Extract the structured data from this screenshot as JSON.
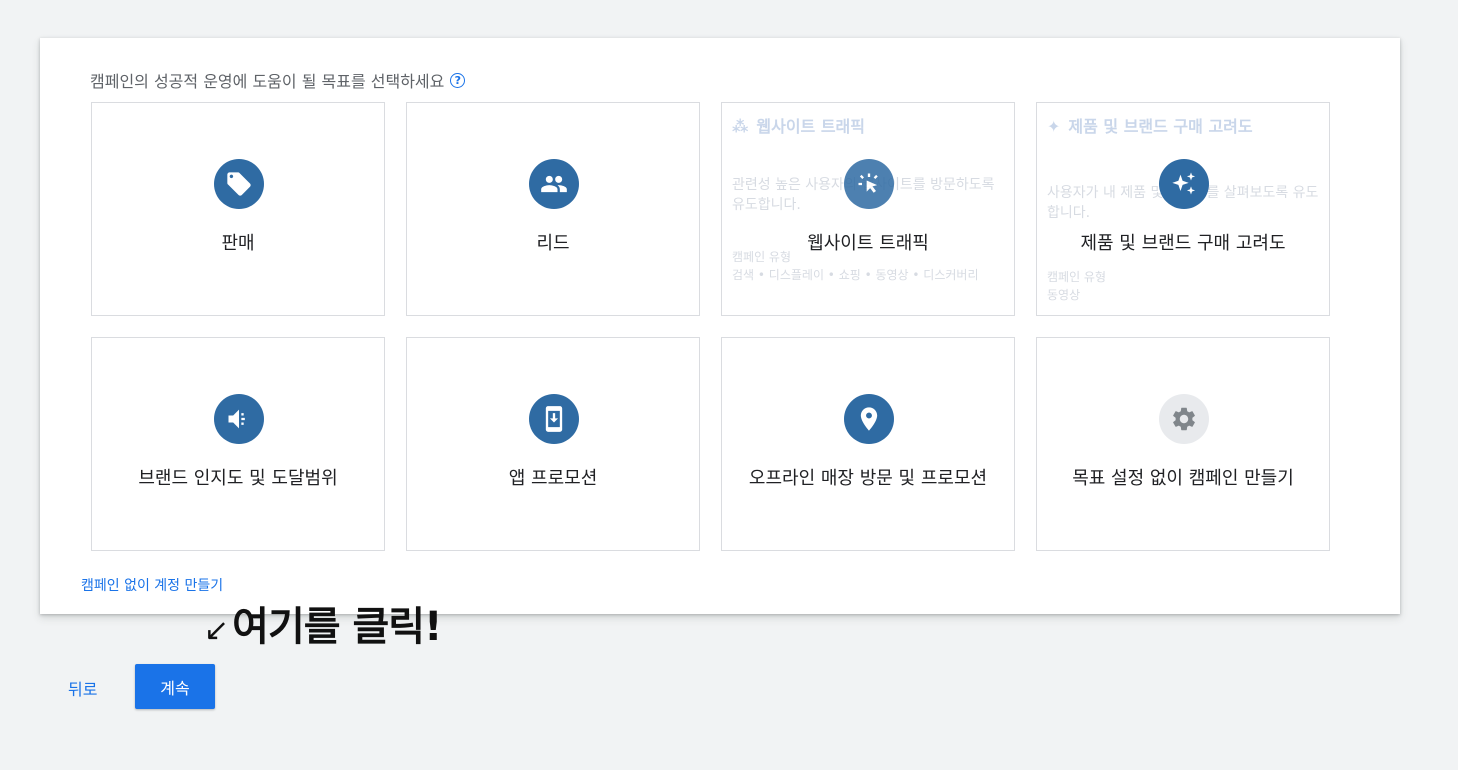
{
  "heading": {
    "text": "캠페인의 성공적 운영에 도움이 될 목표를 선택하세요",
    "help_glyph": "?"
  },
  "goals": [
    {
      "label": "판매",
      "icon": "tag-icon"
    },
    {
      "label": "리드",
      "icon": "people-icon"
    },
    {
      "label": "웹사이트 트래픽",
      "icon": "cursor-click-icon",
      "detail": {
        "title": "웹사이트 트래픽",
        "description": "관련성 높은 사용자의 웹사이트를 방문하도록 유도합니다.",
        "type_label": "캠페인 유형",
        "types": "검색 • 디스플레이 • 쇼핑 • 동영상 • 디스커버리"
      }
    },
    {
      "label": "제품 및 브랜드 구매 고려도",
      "icon": "sparkle-icon",
      "detail": {
        "title": "제품 및 브랜드 구매 고려도",
        "description": "사용자가 내 제품 및 서비스를 살펴보도록 유도합니다.",
        "type_label": "캠페인 유형",
        "types": "동영상"
      }
    },
    {
      "label": "브랜드 인지도 및 도달범위",
      "icon": "megaphone-icon"
    },
    {
      "label": "앱 프로모션",
      "icon": "phone-download-icon"
    },
    {
      "label": "오프라인 매장 방문 및 프로모션",
      "icon": "location-pin-icon"
    },
    {
      "label": "목표 설정 없이 캠페인 만들기",
      "icon": "gear-icon"
    }
  ],
  "create_account_link": "캠페인 없이 계정 만들기",
  "annotation": {
    "arrow": "↙",
    "text": "여기를 클릭!"
  },
  "footer": {
    "back_label": "뒤로",
    "continue_label": "계속"
  },
  "colors": {
    "accent": "#1a73e8",
    "icon_bg": "#2f6ba3",
    "background": "#f1f3f4"
  }
}
